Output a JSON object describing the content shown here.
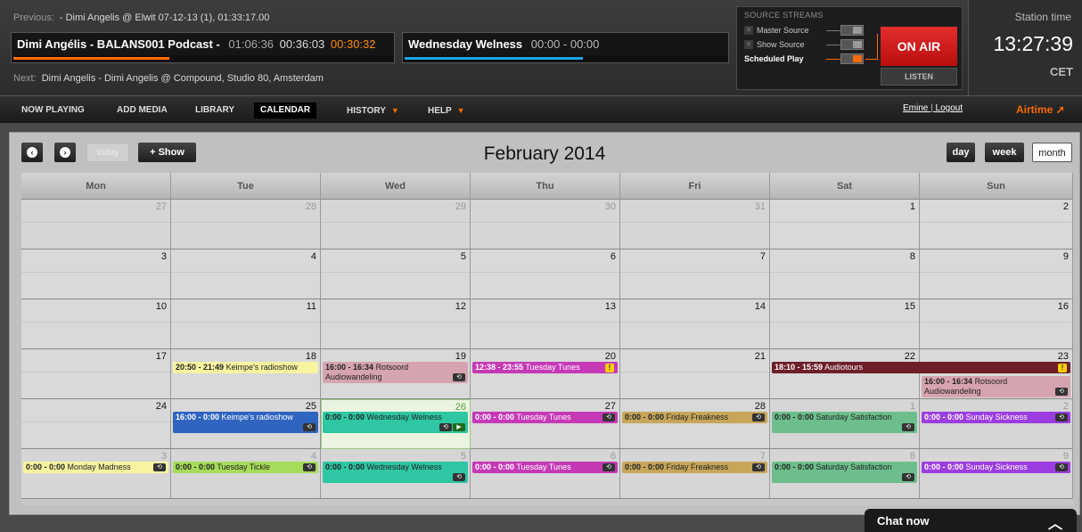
{
  "previous": {
    "label": "Previous:",
    "text": "- Dimi Angelis @ Elwit 07-12-13 (1), 01:33:17.00"
  },
  "current": {
    "title": "Dimi Angélis - BALANS001 Podcast -",
    "elapsed": "01:06:36",
    "length": "00:36:03",
    "remaining": "00:30:32",
    "progress": 0.41
  },
  "current_show": {
    "title": "Wednesday Welness",
    "time": "00:00 - 00:00",
    "progress": 0.55
  },
  "next": {
    "label": "Next:",
    "text": "Dimi Angelis - Dimi Angelis @ Compound, Studio 80, Amsterdam"
  },
  "sources": {
    "header": "SOURCE STREAMS",
    "items": [
      {
        "label": "Master Source",
        "active": false
      },
      {
        "label": "Show Source",
        "active": false
      },
      {
        "label": "Scheduled Play",
        "active": true
      }
    ]
  },
  "on_air": {
    "label": "ON AIR",
    "listen": "LISTEN"
  },
  "station_time": {
    "label": "Station time",
    "time": "13:27:39",
    "tz": "CET"
  },
  "nav": {
    "items": [
      {
        "label": "NOW PLAYING",
        "active": false,
        "dropdown": false
      },
      {
        "label": "ADD MEDIA",
        "active": false,
        "dropdown": false
      },
      {
        "label": "LIBRARY",
        "active": false,
        "dropdown": false
      },
      {
        "label": "CALENDAR",
        "active": true,
        "dropdown": false
      },
      {
        "label": "HISTORY",
        "active": false,
        "dropdown": true
      },
      {
        "label": "HELP",
        "active": false,
        "dropdown": true
      }
    ],
    "user": "Emine",
    "separator": "|",
    "logout": "Logout",
    "logo": "Airtime"
  },
  "calendar": {
    "title": "February 2014",
    "today_label": "today",
    "add_show_label": "+ Show",
    "views": [
      {
        "label": "day",
        "active": false
      },
      {
        "label": "week",
        "active": false
      },
      {
        "label": "month",
        "active": true
      }
    ],
    "weekdays": [
      "Mon",
      "Tue",
      "Wed",
      "Thu",
      "Fri",
      "Sat",
      "Sun"
    ],
    "days": [
      [
        "27",
        "28",
        "29",
        "30",
        "31",
        "1",
        "2"
      ],
      [
        "3",
        "4",
        "5",
        "6",
        "7",
        "8",
        "9"
      ],
      [
        "10",
        "11",
        "12",
        "13",
        "14",
        "15",
        "16"
      ],
      [
        "17",
        "18",
        "19",
        "20",
        "21",
        "22",
        "23"
      ],
      [
        "24",
        "25",
        "26",
        "27",
        "28",
        "1",
        "2"
      ],
      [
        "3",
        "4",
        "5",
        "6",
        "7",
        "8",
        "9"
      ]
    ],
    "events": [
      {
        "row": 3,
        "col": 1,
        "time": "20:50 - 21:49",
        "title": "Keimpe's radioshow",
        "color": "#f7f4a0",
        "text": "#222",
        "icon": "none",
        "slot": 0
      },
      {
        "row": 3,
        "col": 2,
        "time": "16:00 - 16:34",
        "title": "Rotsoord Audiowandeling",
        "color": "#d6a3b0",
        "text": "#222",
        "icon": "repeat",
        "slot": 0,
        "tall": true
      },
      {
        "row": 3,
        "col": 3,
        "time": "12:38 - 23:55",
        "title": "Tuesday Tunes",
        "color": "#c539b6",
        "text": "#fff",
        "icon": "warn",
        "slot": 0
      },
      {
        "row": 3,
        "col": 5,
        "span": 2,
        "time": "18:10 - 15:59",
        "title": "Audiotours",
        "color": "#6d1f2a",
        "text": "#fff",
        "icon": "warn",
        "slot": 0
      },
      {
        "row": 3,
        "col": 6,
        "time": "16:00 - 16:34",
        "title": "Rotsoord Audiowandeling",
        "color": "#d6a3b0",
        "text": "#222",
        "icon": "repeat",
        "slot": 1,
        "tall": true
      },
      {
        "row": 4,
        "col": 1,
        "time": "16:00 - 0:00",
        "title": "Keimpe's radioshow",
        "color": "#2f64c0",
        "text": "#fff",
        "icon": "repeat",
        "slot": 0,
        "tall": true
      },
      {
        "row": 4,
        "col": 2,
        "time": "0:00 - 0:00",
        "title": "Wednesday Welness",
        "color": "#2fc6a4",
        "text": "#222",
        "icon": "repeat-play",
        "slot": 0,
        "tall": true
      },
      {
        "row": 4,
        "col": 3,
        "time": "0:00 - 0:00",
        "title": "Tuesday Tunes",
        "color": "#c539b6",
        "text": "#fff",
        "icon": "repeat",
        "slot": 0
      },
      {
        "row": 4,
        "col": 4,
        "time": "0:00 - 0:00",
        "title": "Friday Freakness",
        "color": "#c7a659",
        "text": "#222",
        "icon": "repeat",
        "slot": 0
      },
      {
        "row": 4,
        "col": 5,
        "time": "0:00 - 0:00",
        "title": "Saturday Satisfaction",
        "color": "#6cbf8c",
        "text": "#222",
        "icon": "repeat",
        "slot": 0,
        "tall": true
      },
      {
        "row": 4,
        "col": 6,
        "time": "0:00 - 0:00",
        "title": "Sunday Sickness",
        "color": "#9b3de0",
        "text": "#fff",
        "icon": "repeat",
        "slot": 0
      },
      {
        "row": 5,
        "col": 0,
        "time": "0:00 - 0:00",
        "title": "Monday Madness",
        "color": "#f7f4a0",
        "text": "#222",
        "icon": "repeat",
        "slot": 0
      },
      {
        "row": 5,
        "col": 1,
        "time": "0:00 - 0:00",
        "title": "Tuesday Tickle",
        "color": "#a6dc5a",
        "text": "#222",
        "icon": "repeat",
        "slot": 0
      },
      {
        "row": 5,
        "col": 2,
        "time": "0:00 - 0:00",
        "title": "Wednesday Welness",
        "color": "#2fc6a4",
        "text": "#222",
        "icon": "repeat",
        "slot": 0,
        "tall": true
      },
      {
        "row": 5,
        "col": 3,
        "time": "0:00 - 0:00",
        "title": "Tuesday Tunes",
        "color": "#c539b6",
        "text": "#fff",
        "icon": "repeat",
        "slot": 0
      },
      {
        "row": 5,
        "col": 4,
        "time": "0:00 - 0:00",
        "title": "Friday Freakness",
        "color": "#c7a659",
        "text": "#222",
        "icon": "repeat",
        "slot": 0
      },
      {
        "row": 5,
        "col": 5,
        "time": "0:00 - 0:00",
        "title": "Saturday Satisfaction",
        "color": "#6cbf8c",
        "text": "#222",
        "icon": "repeat",
        "slot": 0,
        "tall": true
      },
      {
        "row": 5,
        "col": 6,
        "time": "0:00 - 0:00",
        "title": "Sunday Sickness",
        "color": "#9b3de0",
        "text": "#fff",
        "icon": "repeat",
        "slot": 0
      }
    ]
  },
  "chat": {
    "label": "Chat now"
  }
}
